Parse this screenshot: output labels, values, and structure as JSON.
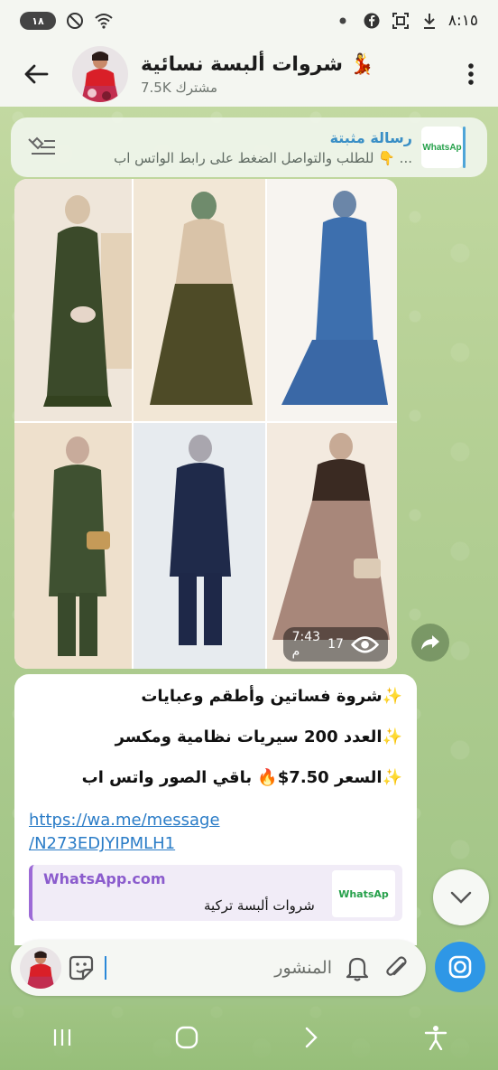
{
  "status_bar": {
    "time": "٨:١٥",
    "battery": "١٨",
    "icons": [
      "facebook-icon",
      "screenshot-icon",
      "download-icon",
      "dot-icon",
      "wifi-icon",
      "dnd-icon"
    ]
  },
  "header": {
    "channel_name": "شروات ألبسة نسائية 💃",
    "subscribers": "7.5K مشترك"
  },
  "pinned": {
    "title": "رسالة مثبتة",
    "body": "للطلب والتواصل الضغط على رابط الواتس اب 👇 ...",
    "thumb_text": "WhatsAp"
  },
  "media": {
    "views": "17",
    "time": "7:43 م"
  },
  "message": {
    "line1": "✨شروة فساتين وأطقم وعبايات",
    "line2": "✨العدد 200 سيريات نظامية ومكسر",
    "line3": "✨السعر 7.50$🔥 باقي الصور واتس اب",
    "link_line1": "https://wa.me/message",
    "link_line2": "/N273EDJYIPMLH1",
    "preview_site": "WhatsApp.com",
    "preview_title": "شروات ألبسة تركية",
    "preview_thumb": "WhatsAp"
  },
  "input": {
    "placeholder": "المنشور"
  },
  "colors": {
    "accent": "#2e97e6",
    "link": "#2a7cc7",
    "preview_accent": "#9c6ad6"
  }
}
